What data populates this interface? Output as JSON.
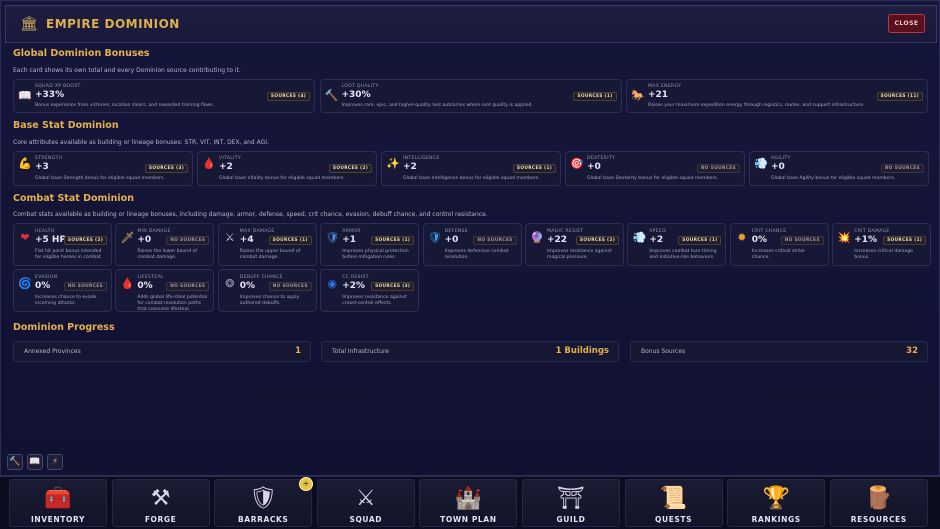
{
  "header": {
    "title": "EMPIRE DOMINION",
    "icon": "temple-icon",
    "close_label": "CLOSE"
  },
  "global": {
    "title": "Global Dominion Bonuses",
    "desc": "Each card shows its own total and every Dominion source contributing to it.",
    "cards": [
      {
        "label": "SQUAD XP BOOST",
        "value": "+33%",
        "badge": "SOURCES (4)",
        "desc": "Bonus experience from victories, location clears, and rewarded training flows.",
        "icon": "book-icon"
      },
      {
        "label": "LOOT QUALITY",
        "value": "+30%",
        "badge": "SOURCES (1)",
        "desc": "Improves rare, epic, and higher-quality loot outcomes where loot quality is applied.",
        "icon": "hammer-icon"
      },
      {
        "label": "MAX ENERGY",
        "value": "+21",
        "badge": "SOURCES (11)",
        "desc": "Raises your maximum expedition energy through logistics, routes, and support infrastructure.",
        "icon": "horse-icon"
      }
    ]
  },
  "base": {
    "title": "Base Stat Dominion",
    "desc": "Core attributes available as building or lineage bonuses: STR, VIT, INT, DEX, and AGI.",
    "cards": [
      {
        "label": "STRENGTH",
        "value": "+3",
        "badge": "SOURCES (3)",
        "desc": "Global base Strength bonus for eligible squad members.",
        "icon": "flexed-arm-icon"
      },
      {
        "label": "VITALITY",
        "value": "+2",
        "badge": "SOURCES (2)",
        "desc": "Global base Vitality bonus for eligible squad members.",
        "icon": "blood-drop-icon"
      },
      {
        "label": "INTELLIGENCE",
        "value": "+2",
        "badge": "SOURCES (1)",
        "desc": "Global base Intelligence bonus for eligible squad members.",
        "icon": "sparkles-icon"
      },
      {
        "label": "DEXTERITY",
        "value": "+0",
        "badge": "NO SOURCES",
        "desc": "Global base Dexterity bonus for eligible squad members.",
        "icon": "target-icon"
      },
      {
        "label": "AGILITY",
        "value": "+0",
        "badge": "NO SOURCES",
        "desc": "Global base Agility bonus for eligible squad members.",
        "icon": "wind-icon"
      }
    ]
  },
  "combat": {
    "title": "Combat Stat Dominion",
    "desc": "Combat stats available as building or lineage bonuses, including damage, armor, defense, speed, crit chance, evasion, debuff chance, and control resistance.",
    "cards": [
      {
        "label": "HEALTH",
        "value": "+5 HP",
        "badge": "SOURCES (2)",
        "desc": "Flat hit point bonus intended for eligible heroes in combat.",
        "icon": "heart-icon",
        "color": "#e0303c"
      },
      {
        "label": "MIN DAMAGE",
        "value": "+0",
        "badge": "NO SOURCES",
        "desc": "Raises the lower bound of combat damage.",
        "icon": "dagger-icon",
        "color": "#f0c070"
      },
      {
        "label": "MAX DAMAGE",
        "value": "+4",
        "badge": "SOURCES (1)",
        "desc": "Raises the upper bound of combat damage.",
        "icon": "crossed-swords-icon",
        "color": "#c8c8d8"
      },
      {
        "label": "ARMOR",
        "value": "+1",
        "badge": "SOURCES (1)",
        "desc": "Improves physical protection before mitigation rules.",
        "icon": "shield-icon",
        "color": "#4a90e0"
      },
      {
        "label": "DEFENSE",
        "value": "+0",
        "badge": "NO SOURCES",
        "desc": "Improves defensive combat resolution.",
        "icon": "defense-shield-icon",
        "color": "#3aa0e8"
      },
      {
        "label": "MAGIC RESIST",
        "value": "+22",
        "badge": "SOURCES (2)",
        "desc": "Improves resistance against magical pressure.",
        "icon": "crystal-ball-icon",
        "color": "#9060d0"
      },
      {
        "label": "SPEED",
        "value": "+2",
        "badge": "SOURCES (1)",
        "desc": "Improves combat turn timing and initiative-like behaviors.",
        "icon": "wind-icon",
        "color": "#d0d0e0"
      },
      {
        "label": "CRIT CHANCE",
        "value": "0%",
        "badge": "NO SOURCES",
        "desc": "Increases critical strike chance.",
        "icon": "star-burst-icon",
        "color": "#f0a030"
      },
      {
        "label": "CRIT DAMAGE",
        "value": "+1%",
        "badge": "SOURCES (1)",
        "desc": "Increases critical damage bonus.",
        "icon": "explosion-icon",
        "color": "#f06040"
      },
      {
        "label": "EVASION",
        "value": "0%",
        "badge": "NO SOURCES",
        "desc": "Increases chance to evade incoming attacks.",
        "icon": "swirl-icon",
        "color": "#3070e0"
      },
      {
        "label": "LIFESTEAL",
        "value": "0%",
        "badge": "NO SOURCES",
        "desc": "Adds global life-steal potential for combat resolution paths that consume lifesteal.",
        "icon": "blood-drop-icon",
        "color": "#d02030"
      },
      {
        "label": "DEBUFF CHANCE",
        "value": "0%",
        "badge": "NO SOURCES",
        "desc": "Improves chance to apply authored debuffs.",
        "icon": "virus-icon",
        "color": "#a0a0b8"
      },
      {
        "label": "CC RESIST",
        "value": "+2%",
        "badge": "SOURCES (3)",
        "desc": "Improves resistance against crowd-control effects.",
        "icon": "eye-ring-icon",
        "color": "#3070e0"
      }
    ]
  },
  "progress": {
    "title": "Dominion Progress",
    "items": [
      {
        "label": "Annexed Provinces",
        "value": "1"
      },
      {
        "label": "Total Infrastructure",
        "value": "1 Buildings"
      },
      {
        "label": "Bonus Sources",
        "value": "32"
      }
    ]
  },
  "tools": [
    {
      "name": "hammer-tool-button",
      "icon": "hammer-icon"
    },
    {
      "name": "book-tool-button",
      "icon": "book-icon"
    },
    {
      "name": "lightning-tool-button",
      "icon": "lightning-icon"
    }
  ],
  "nav": [
    {
      "label": "INVENTORY",
      "icon": "treasure-chest-icon"
    },
    {
      "label": "FORGE",
      "icon": "anvil-icon"
    },
    {
      "label": "BARRACKS",
      "icon": "shield-spear-icon"
    },
    {
      "label": "SQUAD",
      "icon": "soldiers-icon"
    },
    {
      "label": "TOWN PLAN",
      "icon": "castle-icon"
    },
    {
      "label": "GUILD",
      "icon": "gate-icon"
    },
    {
      "label": "QUESTS",
      "icon": "scroll-icon"
    },
    {
      "label": "RANKINGS",
      "icon": "trophy-icon"
    },
    {
      "label": "RESOURCES",
      "icon": "resource-pile-icon"
    }
  ],
  "notification_icon": "plus-icon",
  "colors": {
    "accent": "#e3b04b",
    "panel": "#15163a",
    "close": "#5a0f1c"
  }
}
